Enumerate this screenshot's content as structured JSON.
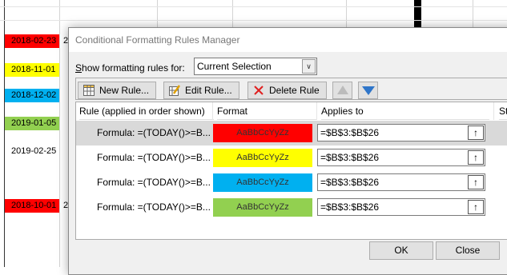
{
  "sheet": {
    "cells": [
      {
        "text": "2018-02-23",
        "bg": "#ff0000",
        "side": "2"
      },
      {
        "text": "2018-11-01",
        "bg": "#ffff00",
        "side": ""
      },
      {
        "text": "2018-12-02",
        "bg": "#00b0f0",
        "side": ""
      },
      {
        "text": "2019-01-05",
        "bg": "#92d050",
        "side": ""
      },
      {
        "text": "2019-02-25",
        "bg": "#ffffff",
        "side": ""
      },
      {
        "text": "2018-10-01",
        "bg": "#ff0000",
        "side": "2"
      }
    ],
    "left_mark": "."
  },
  "dialog": {
    "title": "Conditional Formatting Rules Manager",
    "show_label": "Show formatting rules for:",
    "show_value": "Current Selection",
    "toolbar": {
      "new_rule": "New Rule...",
      "edit_rule": "Edit Rule...",
      "delete_rule": "Delete Rule"
    },
    "columns": {
      "rule": "Rule (applied in order shown)",
      "format": "Format",
      "applies": "Applies to",
      "stop": "St"
    },
    "rules": [
      {
        "formula": "Formula: =(TODAY()>=B...",
        "preview": "AaBbCcYyZz",
        "color": "#ff0000",
        "applies": "=$B$3:$B$26"
      },
      {
        "formula": "Formula: =(TODAY()>=B...",
        "preview": "AaBbCcYyZz",
        "color": "#ffff00",
        "applies": "=$B$3:$B$26"
      },
      {
        "formula": "Formula: =(TODAY()>=B...",
        "preview": "AaBbCcYyZz",
        "color": "#00b0f0",
        "applies": "=$B$3:$B$26"
      },
      {
        "formula": "Formula: =(TODAY()>=B...",
        "preview": "AaBbCcYyZz",
        "color": "#92d050",
        "applies": "=$B$3:$B$26"
      }
    ],
    "ok_label": "OK",
    "close_label": "Close"
  },
  "icons": {
    "new_rule": "table-grid-icon",
    "edit_rule": "edit-table-icon",
    "delete_rule": "red-x-icon",
    "move_up": "triangle-up-icon",
    "move_down": "triangle-down-icon",
    "collapse": "collapse-arrow-icon"
  }
}
